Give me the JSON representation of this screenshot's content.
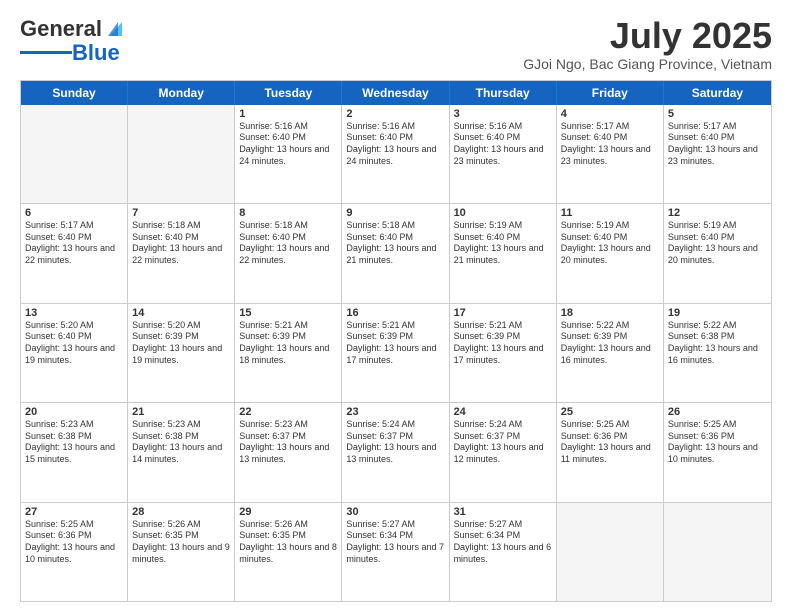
{
  "logo": {
    "line1": "General",
    "line2": "Blue"
  },
  "title": "July 2025",
  "subtitle": "GJoi Ngo, Bac Giang Province, Vietnam",
  "days_of_week": [
    "Sunday",
    "Monday",
    "Tuesday",
    "Wednesday",
    "Thursday",
    "Friday",
    "Saturday"
  ],
  "weeks": [
    [
      {
        "day": "",
        "info": ""
      },
      {
        "day": "",
        "info": ""
      },
      {
        "day": "1",
        "info": "Sunrise: 5:16 AM\nSunset: 6:40 PM\nDaylight: 13 hours and 24 minutes."
      },
      {
        "day": "2",
        "info": "Sunrise: 5:16 AM\nSunset: 6:40 PM\nDaylight: 13 hours and 24 minutes."
      },
      {
        "day": "3",
        "info": "Sunrise: 5:16 AM\nSunset: 6:40 PM\nDaylight: 13 hours and 23 minutes."
      },
      {
        "day": "4",
        "info": "Sunrise: 5:17 AM\nSunset: 6:40 PM\nDaylight: 13 hours and 23 minutes."
      },
      {
        "day": "5",
        "info": "Sunrise: 5:17 AM\nSunset: 6:40 PM\nDaylight: 13 hours and 23 minutes."
      }
    ],
    [
      {
        "day": "6",
        "info": "Sunrise: 5:17 AM\nSunset: 6:40 PM\nDaylight: 13 hours and 22 minutes."
      },
      {
        "day": "7",
        "info": "Sunrise: 5:18 AM\nSunset: 6:40 PM\nDaylight: 13 hours and 22 minutes."
      },
      {
        "day": "8",
        "info": "Sunrise: 5:18 AM\nSunset: 6:40 PM\nDaylight: 13 hours and 22 minutes."
      },
      {
        "day": "9",
        "info": "Sunrise: 5:18 AM\nSunset: 6:40 PM\nDaylight: 13 hours and 21 minutes."
      },
      {
        "day": "10",
        "info": "Sunrise: 5:19 AM\nSunset: 6:40 PM\nDaylight: 13 hours and 21 minutes."
      },
      {
        "day": "11",
        "info": "Sunrise: 5:19 AM\nSunset: 6:40 PM\nDaylight: 13 hours and 20 minutes."
      },
      {
        "day": "12",
        "info": "Sunrise: 5:19 AM\nSunset: 6:40 PM\nDaylight: 13 hours and 20 minutes."
      }
    ],
    [
      {
        "day": "13",
        "info": "Sunrise: 5:20 AM\nSunset: 6:40 PM\nDaylight: 13 hours and 19 minutes."
      },
      {
        "day": "14",
        "info": "Sunrise: 5:20 AM\nSunset: 6:39 PM\nDaylight: 13 hours and 19 minutes."
      },
      {
        "day": "15",
        "info": "Sunrise: 5:21 AM\nSunset: 6:39 PM\nDaylight: 13 hours and 18 minutes."
      },
      {
        "day": "16",
        "info": "Sunrise: 5:21 AM\nSunset: 6:39 PM\nDaylight: 13 hours and 17 minutes."
      },
      {
        "day": "17",
        "info": "Sunrise: 5:21 AM\nSunset: 6:39 PM\nDaylight: 13 hours and 17 minutes."
      },
      {
        "day": "18",
        "info": "Sunrise: 5:22 AM\nSunset: 6:39 PM\nDaylight: 13 hours and 16 minutes."
      },
      {
        "day": "19",
        "info": "Sunrise: 5:22 AM\nSunset: 6:38 PM\nDaylight: 13 hours and 16 minutes."
      }
    ],
    [
      {
        "day": "20",
        "info": "Sunrise: 5:23 AM\nSunset: 6:38 PM\nDaylight: 13 hours and 15 minutes."
      },
      {
        "day": "21",
        "info": "Sunrise: 5:23 AM\nSunset: 6:38 PM\nDaylight: 13 hours and 14 minutes."
      },
      {
        "day": "22",
        "info": "Sunrise: 5:23 AM\nSunset: 6:37 PM\nDaylight: 13 hours and 13 minutes."
      },
      {
        "day": "23",
        "info": "Sunrise: 5:24 AM\nSunset: 6:37 PM\nDaylight: 13 hours and 13 minutes."
      },
      {
        "day": "24",
        "info": "Sunrise: 5:24 AM\nSunset: 6:37 PM\nDaylight: 13 hours and 12 minutes."
      },
      {
        "day": "25",
        "info": "Sunrise: 5:25 AM\nSunset: 6:36 PM\nDaylight: 13 hours and 11 minutes."
      },
      {
        "day": "26",
        "info": "Sunrise: 5:25 AM\nSunset: 6:36 PM\nDaylight: 13 hours and 10 minutes."
      }
    ],
    [
      {
        "day": "27",
        "info": "Sunrise: 5:25 AM\nSunset: 6:36 PM\nDaylight: 13 hours and 10 minutes."
      },
      {
        "day": "28",
        "info": "Sunrise: 5:26 AM\nSunset: 6:35 PM\nDaylight: 13 hours and 9 minutes."
      },
      {
        "day": "29",
        "info": "Sunrise: 5:26 AM\nSunset: 6:35 PM\nDaylight: 13 hours and 8 minutes."
      },
      {
        "day": "30",
        "info": "Sunrise: 5:27 AM\nSunset: 6:34 PM\nDaylight: 13 hours and 7 minutes."
      },
      {
        "day": "31",
        "info": "Sunrise: 5:27 AM\nSunset: 6:34 PM\nDaylight: 13 hours and 6 minutes."
      },
      {
        "day": "",
        "info": ""
      },
      {
        "day": "",
        "info": ""
      }
    ]
  ]
}
